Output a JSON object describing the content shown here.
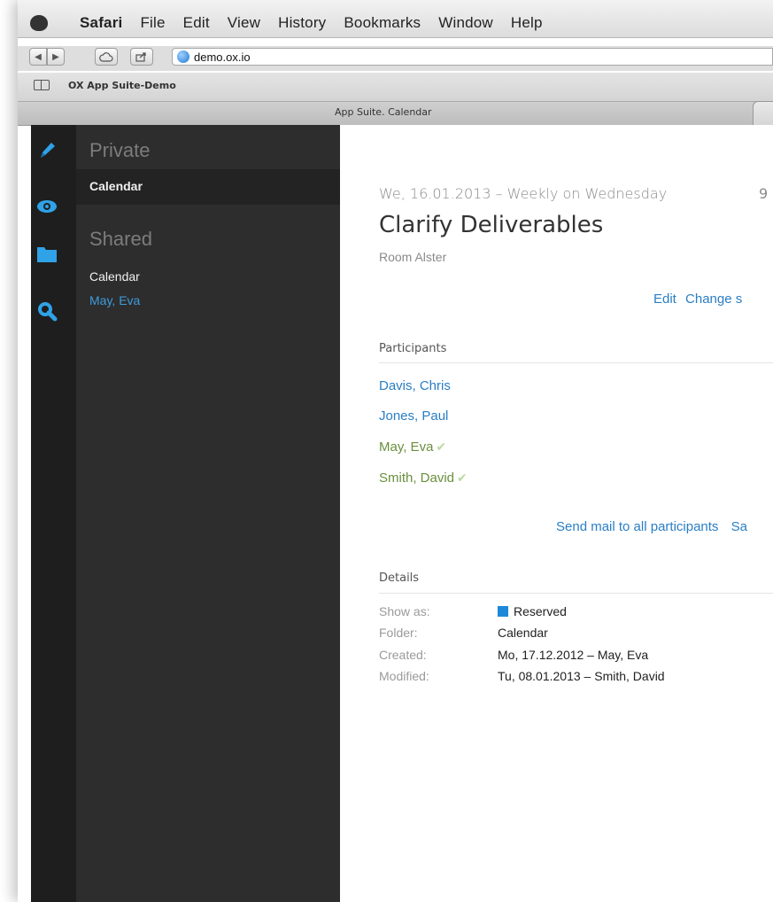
{
  "menubar": {
    "items": [
      "Safari",
      "File",
      "Edit",
      "View",
      "History",
      "Bookmarks",
      "Window",
      "Help"
    ]
  },
  "toolbar": {
    "url": "demo.ox.io"
  },
  "bookmarks": {
    "label": "OX App Suite-Demo"
  },
  "tab": {
    "title": "App Suite. Calendar"
  },
  "sidebar": {
    "private_heading": "Private",
    "private_item": "Calendar",
    "shared_heading": "Shared",
    "shared_item": "Calendar",
    "shared_user": "May, Eva"
  },
  "appointment": {
    "date": "We, 16.01.2013 – Weekly on Wednesday",
    "time_fragment": "9",
    "title": "Clarify Deliverables",
    "location": "Room Alster",
    "actions": {
      "edit": "Edit",
      "change": "Change s"
    },
    "participants_label": "Participants",
    "participants": [
      {
        "name": "Davis, Chris",
        "accepted": false
      },
      {
        "name": "Jones, Paul",
        "accepted": false
      },
      {
        "name": "May, Eva",
        "accepted": true
      },
      {
        "name": "Smith, David",
        "accepted": true
      }
    ],
    "send_mail": "Send mail to all participants",
    "send_mail_fragment": "Sa",
    "details_label": "Details",
    "details": [
      {
        "label": "Show as:",
        "value": "Reserved"
      },
      {
        "label": "Folder:",
        "value": "Calendar"
      },
      {
        "label": "Created:",
        "value": "Mo, 17.12.2012 – May, Eva"
      },
      {
        "label": "Modified:",
        "value": "Tu, 08.01.2013 – Smith, David"
      }
    ]
  },
  "colors": {
    "accent_blue": "#2a7ec5",
    "accepted_green": "#6a8f3e",
    "reserved_swatch": "#1e88d8",
    "sidebar_bg": "#2d2d2d",
    "iconbar_bg": "#1e1e1e"
  },
  "icons": [
    "apple-icon",
    "back-icon",
    "forward-icon",
    "cloud-icon",
    "share-icon",
    "globe-icon",
    "bookmarks-book-icon",
    "pencil-icon",
    "eye-icon",
    "folder-icon",
    "search-icon",
    "check-icon"
  ]
}
